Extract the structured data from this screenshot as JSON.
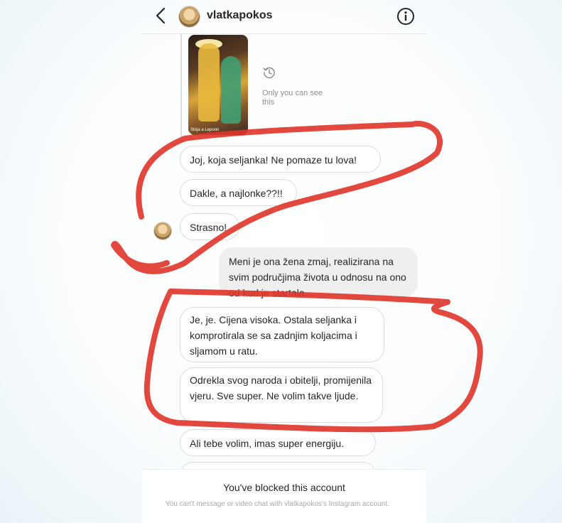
{
  "header": {
    "username": "vlatkapokos",
    "icons": {
      "back": "chevron-left-icon",
      "info": "info-circle-icon"
    }
  },
  "story_reply": {
    "caption": "Stoja a Lepoon",
    "notice": "Only you can see this",
    "icon": "history-icon"
  },
  "messages": [
    {
      "text": "Joj, koja seljanka! Ne pomaze tu lova!",
      "sender": "them"
    },
    {
      "text": "Dakle, a najlonke??!!",
      "sender": "them"
    },
    {
      "text": "Strasno!",
      "sender": "them"
    },
    {
      "text": "Meni je ona žena zmaj, realizirana na svim područjima života u odnosu na ono od kud je startala.",
      "sender": "me"
    },
    {
      "text": "Je, je. Cijena visoka. Ostala seljanka i komprotirala se sa zadnjim koljacima i sljamom u ratu.",
      "sender": "them"
    },
    {
      "text": "Odrekla svog naroda i obitelji, promijenila vjeru. Sve super. Ne volim takve ljude.",
      "sender": "them"
    },
    {
      "text": "Ali tebe volim, imas super energiju.",
      "sender": "them"
    }
  ],
  "footer": {
    "title": "You've blocked this account",
    "subtitle": "You can't message or video chat with vlatkapokos's Instagram account."
  },
  "colors": {
    "annotation_red": "#e0342a",
    "bubble_border": "#dbdbdb",
    "sent_bubble": "#efefef"
  }
}
